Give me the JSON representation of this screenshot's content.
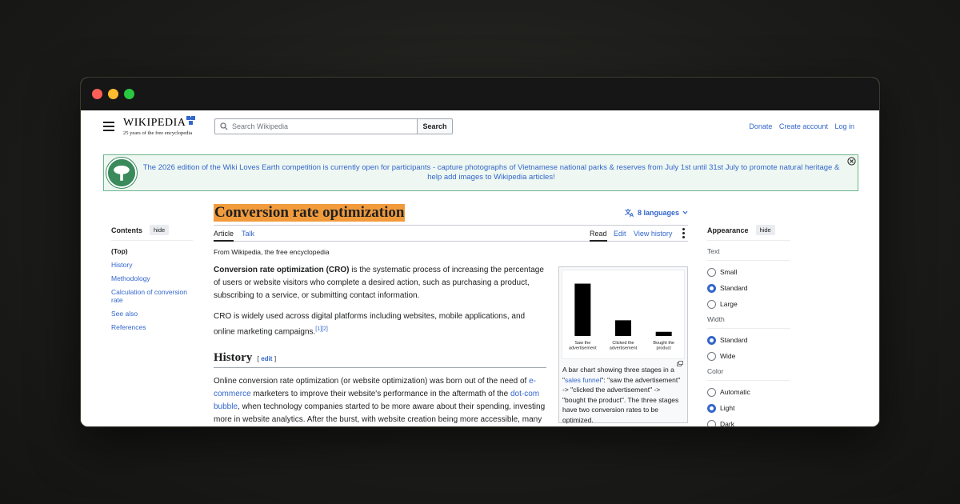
{
  "header": {
    "logo_word": "WIKIPEDIA",
    "logo_tagline": "25 years of the free encyclopedia",
    "search_placeholder": "Search Wikipedia",
    "search_button": "Search",
    "user_links": [
      "Donate",
      "Create account",
      "Log in"
    ]
  },
  "banner": {
    "text": "The 2026 edition of the Wiki Loves Earth competition is currently open for participants - capture photographs of Vietnamese national parks & reserves from July 1st until 31st July to promote natural heritage & help add images to Wikipedia articles!"
  },
  "toc": {
    "title": "Contents",
    "hide": "hide",
    "items": [
      "(Top)",
      "History",
      "Methodology",
      "Calculation of conversion rate",
      "See also",
      "References"
    ]
  },
  "article": {
    "title": "Conversion rate optimization",
    "languages": "8 languages",
    "tabs_left": [
      "Article",
      "Talk"
    ],
    "tabs_right": [
      "Read",
      "Edit",
      "View history"
    ],
    "from": "From Wikipedia, the free encyclopedia",
    "intro_bold": "Conversion rate optimization (CRO)",
    "intro_rest": " is the systematic process of increasing the percentage of users or website visitors who complete a desired action, such as purchasing a product, subscribing to a service, or submitting contact information.",
    "p2": "CRO is widely used across digital platforms including websites, mobile applications, and online marketing campaigns.",
    "p2_refs": "[1][2]",
    "history_heading": "History",
    "edit_open": "[ ",
    "edit_label": "edit",
    "edit_close": " ]",
    "hist_a": "Online conversion rate optimization (or website optimization) was born out of the need of ",
    "hist_link1": "e-commerce",
    "hist_b": " marketers to improve their website's performance in the aftermath of the ",
    "hist_link2": "dot-com bubble",
    "hist_c": ", when technology companies started to be more aware about their spending, investing more in website analytics. After the burst, with website creation being more accessible, many"
  },
  "figure": {
    "caption_a": "A bar chart showing three stages in a \"",
    "caption_link": "sales funnel",
    "caption_b": "\": \"saw the advertisement\" -> \"clicked the advertisement\" -> \"bought the product\". The three stages have two conversion rates to be optimized."
  },
  "chart_data": {
    "type": "bar",
    "categories": [
      "Saw the advertisement",
      "Clicked the advertisement",
      "Bought the product"
    ],
    "values": [
      100,
      30,
      8
    ],
    "ylim": [
      0,
      110
    ],
    "color": "#000000"
  },
  "appearance": {
    "title": "Appearance",
    "hide": "hide",
    "groups": [
      {
        "label": "Text",
        "options": [
          "Small",
          "Standard",
          "Large"
        ],
        "selected": 1
      },
      {
        "label": "Width",
        "options": [
          "Standard",
          "Wide"
        ],
        "selected": 0
      },
      {
        "label": "Color",
        "options": [
          "Automatic",
          "Light",
          "Dark"
        ],
        "selected": 1
      }
    ]
  },
  "colors": {
    "link": "#3366cc",
    "highlight": "#f29b3c",
    "radio_on": "#3366cc"
  }
}
